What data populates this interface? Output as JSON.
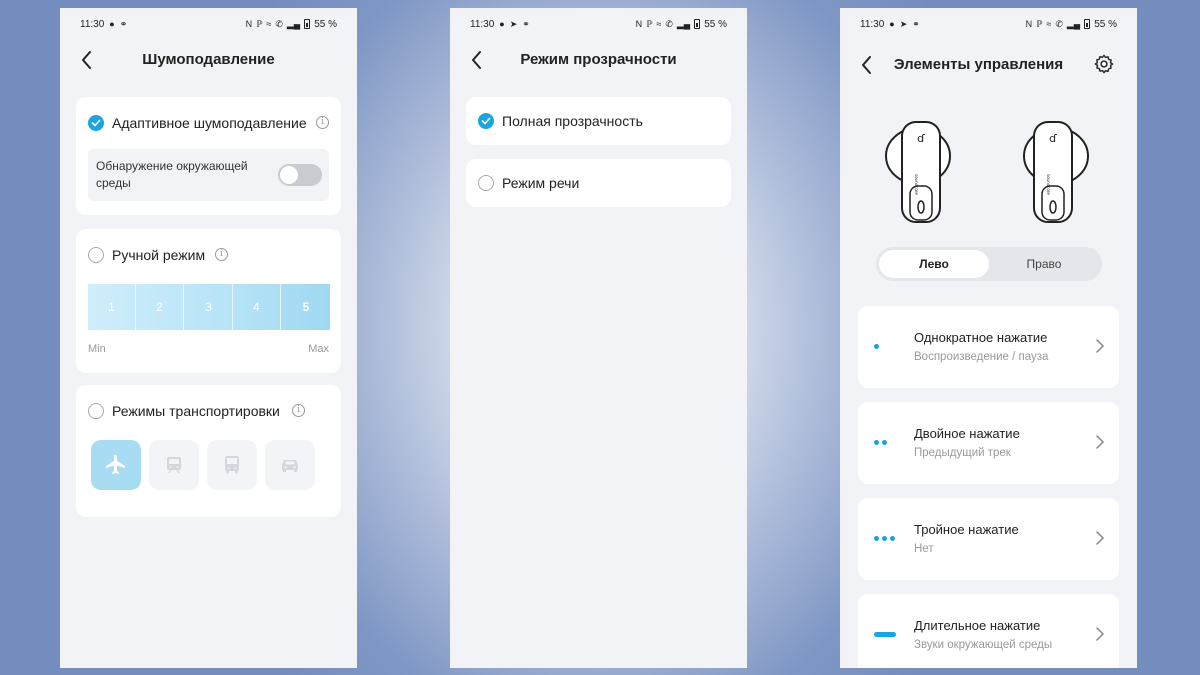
{
  "colors": {
    "accent": "#1ba4e4",
    "page_bg": "#f2f3f7",
    "card_bg": "#ffffff",
    "slider_active": "#a8dcf3"
  },
  "status_bar": {
    "time": "11:30",
    "battery": "55 %"
  },
  "screen1": {
    "title": "Шумоподавление",
    "adaptive": {
      "label": "Адаптивное шумоподавление",
      "checked": true,
      "env_detection_label": "Обнаружение окружающей среды",
      "env_detection_on": false
    },
    "manual": {
      "label": "Ручной режим",
      "checked": false,
      "levels": [
        "1",
        "2",
        "3",
        "4",
        "5"
      ],
      "selected_level": "5",
      "min_label": "Min",
      "max_label": "Max"
    },
    "transport": {
      "label": "Режимы транспортировки",
      "checked": false,
      "modes": [
        "airplane-icon",
        "train-icon",
        "bus-icon",
        "car-icon"
      ],
      "active_mode": "airplane-icon"
    }
  },
  "screen2": {
    "title": "Режим прозрачности",
    "options": [
      {
        "label": "Полная прозрачность",
        "checked": true
      },
      {
        "label": "Режим речи",
        "checked": false
      }
    ]
  },
  "screen3": {
    "title": "Элементы управления",
    "earbud_brand": "soundcore",
    "tabs": [
      "Лево",
      "Право"
    ],
    "active_tab": "Лево",
    "controls": [
      {
        "title": "Однократное нажатие",
        "action": "Воспроизведение / пауза",
        "indicator": "single-dot"
      },
      {
        "title": "Двойное нажатие",
        "action": "Предыдущий трек",
        "indicator": "double-dot"
      },
      {
        "title": "Тройное нажатие",
        "action": "Нет",
        "indicator": "triple-dot"
      },
      {
        "title": "Длительное нажатие",
        "action": "Звуки окружающей среды",
        "indicator": "long-dash"
      }
    ]
  }
}
